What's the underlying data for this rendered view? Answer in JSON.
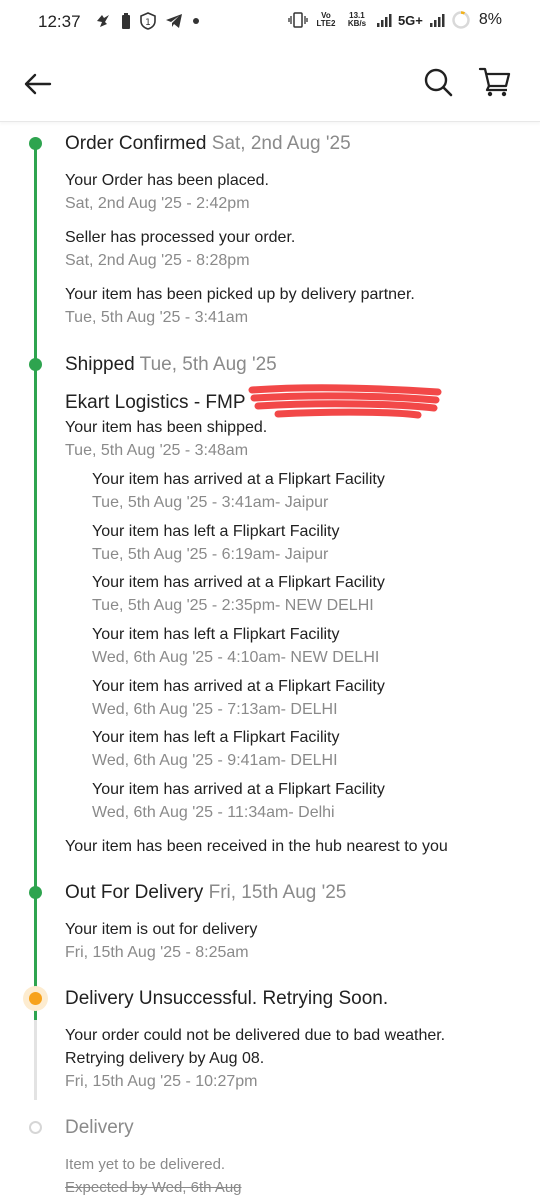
{
  "status_bar": {
    "time": "12:37",
    "net_top": "Vo LTE2",
    "net_rate": "13.1 KB/s",
    "signal_label": "5G+",
    "battery": "8%"
  },
  "header": {
    "back_icon": "arrow-left-icon",
    "search_icon": "search-icon",
    "cart_icon": "cart-icon"
  },
  "colors": {
    "done": "#2ea44f",
    "pending": "#f7a21b",
    "inactive": "#d6d6d6"
  },
  "timeline": {
    "confirmed": {
      "title": "Order Confirmed",
      "date": "Sat, 2nd Aug '25",
      "events": [
        {
          "msg": "Your Order has been placed.",
          "time": "Sat, 2nd Aug '25 - 2:42pm"
        },
        {
          "msg": "Seller has processed your order.",
          "time": "Sat, 2nd Aug '25 - 8:28pm"
        },
        {
          "msg": "Your item has been picked up by delivery partner.",
          "time": "Tue, 5th Aug '25 - 3:41am"
        }
      ]
    },
    "shipped": {
      "title": "Shipped",
      "date": "Tue, 5th Aug '25",
      "courier": "Ekart Logistics - FMP",
      "msg": "Your item has been shipped.",
      "time": "Tue, 5th Aug '25 - 3:48am",
      "sub_events": [
        {
          "msg": "Your item has arrived at a Flipkart Facility",
          "time": "Tue, 5th Aug '25 - 3:41am- Jaipur"
        },
        {
          "msg": "Your item has left a Flipkart Facility",
          "time": "Tue, 5th Aug '25 - 6:19am- Jaipur"
        },
        {
          "msg": "Your item has arrived at a Flipkart Facility",
          "time": "Tue, 5th Aug '25 - 2:35pm- NEW DELHI"
        },
        {
          "msg": "Your item has left a Flipkart Facility",
          "time": "Wed, 6th Aug '25 - 4:10am- NEW DELHI"
        },
        {
          "msg": "Your item has arrived at a Flipkart Facility",
          "time": "Wed, 6th Aug '25 - 7:13am- DELHI"
        },
        {
          "msg": "Your item has left a Flipkart Facility",
          "time": "Wed, 6th Aug '25 - 9:41am- DELHI"
        },
        {
          "msg": "Your item has arrived at a Flipkart Facility",
          "time": "Wed, 6th Aug '25 - 11:34am- Delhi"
        }
      ],
      "hub_msg": "Your item has been received in the hub nearest to you"
    },
    "out_for_delivery": {
      "title": "Out For Delivery",
      "date": "Fri, 15th Aug '25",
      "msg": "Your item is out for delivery",
      "time": "Fri, 15th Aug '25 - 8:25am"
    },
    "unsuccessful": {
      "title": "Delivery Unsuccessful. Retrying Soon.",
      "msg1": "Your order could not be delivered due to bad weather.",
      "msg2": "Retrying delivery by Aug 08.",
      "time": "Fri, 15th Aug '25 - 10:27pm"
    },
    "delivery": {
      "title": "Delivery",
      "msg": "Item yet to be delivered.",
      "expected": "Expected by Wed, 6th Aug"
    }
  }
}
